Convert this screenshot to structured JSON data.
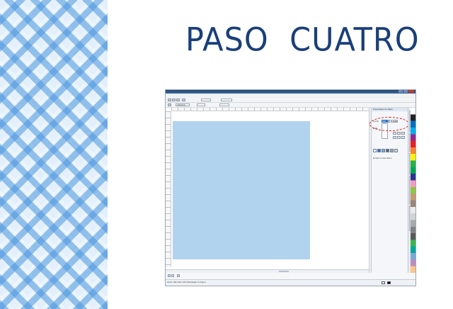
{
  "slide": {
    "title": "PASO  CUATRO"
  },
  "app": {
    "window_title": "",
    "menu": [
      "",
      "",
      "",
      "",
      "",
      "",
      "",
      "",
      ""
    ],
    "toolbar2": {
      "units_value": "milimetros",
      "x_value": "",
      "y_value": ""
    },
    "docker": {
      "header": "Propiedades de objeto",
      "size_label": "Ancho:",
      "size_value": "100",
      "units_value": "Lineales",
      "size_options": [
        "",
        "",
        "",
        "",
        "",
        "",
        "",
        ""
      ],
      "style_label": "Estilo:",
      "note": "El objeto no tiene relleno"
    },
    "status": {
      "text": "Ancho: 100.0  Alto: 100.0  Rectángulo en Capa 1"
    }
  },
  "colors": {
    "gingham_dark": "#4a96de",
    "gingham_light": "#e3f0fb",
    "title_color": "#1a3f7a",
    "square_fill": "#b1d3ee",
    "highlight": "#d11a1a",
    "titlebar": "#24466f"
  }
}
